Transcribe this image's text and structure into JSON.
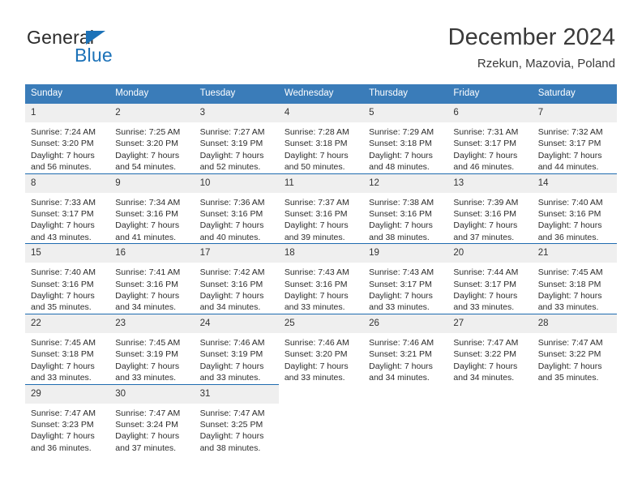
{
  "brand": {
    "line1": "General",
    "line2": "Blue",
    "triangle_color": "#1c72b8"
  },
  "header": {
    "title": "December 2024",
    "subtitle": "Rzekun, Mazovia, Poland"
  },
  "theme": {
    "header_bg": "#3a7cb9",
    "row_divider": "#1f6cb0",
    "daynum_bg": "#efefef",
    "text": "#2c2c2c"
  },
  "weekday_headers": [
    "Sunday",
    "Monday",
    "Tuesday",
    "Wednesday",
    "Thursday",
    "Friday",
    "Saturday"
  ],
  "weeks": [
    {
      "days": [
        {
          "num": "1",
          "sunrise": "Sunrise: 7:24 AM",
          "sunset": "Sunset: 3:20 PM",
          "daylight_1": "Daylight: 7 hours",
          "daylight_2": "and 56 minutes."
        },
        {
          "num": "2",
          "sunrise": "Sunrise: 7:25 AM",
          "sunset": "Sunset: 3:20 PM",
          "daylight_1": "Daylight: 7 hours",
          "daylight_2": "and 54 minutes."
        },
        {
          "num": "3",
          "sunrise": "Sunrise: 7:27 AM",
          "sunset": "Sunset: 3:19 PM",
          "daylight_1": "Daylight: 7 hours",
          "daylight_2": "and 52 minutes."
        },
        {
          "num": "4",
          "sunrise": "Sunrise: 7:28 AM",
          "sunset": "Sunset: 3:18 PM",
          "daylight_1": "Daylight: 7 hours",
          "daylight_2": "and 50 minutes."
        },
        {
          "num": "5",
          "sunrise": "Sunrise: 7:29 AM",
          "sunset": "Sunset: 3:18 PM",
          "daylight_1": "Daylight: 7 hours",
          "daylight_2": "and 48 minutes."
        },
        {
          "num": "6",
          "sunrise": "Sunrise: 7:31 AM",
          "sunset": "Sunset: 3:17 PM",
          "daylight_1": "Daylight: 7 hours",
          "daylight_2": "and 46 minutes."
        },
        {
          "num": "7",
          "sunrise": "Sunrise: 7:32 AM",
          "sunset": "Sunset: 3:17 PM",
          "daylight_1": "Daylight: 7 hours",
          "daylight_2": "and 44 minutes."
        }
      ]
    },
    {
      "days": [
        {
          "num": "8",
          "sunrise": "Sunrise: 7:33 AM",
          "sunset": "Sunset: 3:17 PM",
          "daylight_1": "Daylight: 7 hours",
          "daylight_2": "and 43 minutes."
        },
        {
          "num": "9",
          "sunrise": "Sunrise: 7:34 AM",
          "sunset": "Sunset: 3:16 PM",
          "daylight_1": "Daylight: 7 hours",
          "daylight_2": "and 41 minutes."
        },
        {
          "num": "10",
          "sunrise": "Sunrise: 7:36 AM",
          "sunset": "Sunset: 3:16 PM",
          "daylight_1": "Daylight: 7 hours",
          "daylight_2": "and 40 minutes."
        },
        {
          "num": "11",
          "sunrise": "Sunrise: 7:37 AM",
          "sunset": "Sunset: 3:16 PM",
          "daylight_1": "Daylight: 7 hours",
          "daylight_2": "and 39 minutes."
        },
        {
          "num": "12",
          "sunrise": "Sunrise: 7:38 AM",
          "sunset": "Sunset: 3:16 PM",
          "daylight_1": "Daylight: 7 hours",
          "daylight_2": "and 38 minutes."
        },
        {
          "num": "13",
          "sunrise": "Sunrise: 7:39 AM",
          "sunset": "Sunset: 3:16 PM",
          "daylight_1": "Daylight: 7 hours",
          "daylight_2": "and 37 minutes."
        },
        {
          "num": "14",
          "sunrise": "Sunrise: 7:40 AM",
          "sunset": "Sunset: 3:16 PM",
          "daylight_1": "Daylight: 7 hours",
          "daylight_2": "and 36 minutes."
        }
      ]
    },
    {
      "days": [
        {
          "num": "15",
          "sunrise": "Sunrise: 7:40 AM",
          "sunset": "Sunset: 3:16 PM",
          "daylight_1": "Daylight: 7 hours",
          "daylight_2": "and 35 minutes."
        },
        {
          "num": "16",
          "sunrise": "Sunrise: 7:41 AM",
          "sunset": "Sunset: 3:16 PM",
          "daylight_1": "Daylight: 7 hours",
          "daylight_2": "and 34 minutes."
        },
        {
          "num": "17",
          "sunrise": "Sunrise: 7:42 AM",
          "sunset": "Sunset: 3:16 PM",
          "daylight_1": "Daylight: 7 hours",
          "daylight_2": "and 34 minutes."
        },
        {
          "num": "18",
          "sunrise": "Sunrise: 7:43 AM",
          "sunset": "Sunset: 3:16 PM",
          "daylight_1": "Daylight: 7 hours",
          "daylight_2": "and 33 minutes."
        },
        {
          "num": "19",
          "sunrise": "Sunrise: 7:43 AM",
          "sunset": "Sunset: 3:17 PM",
          "daylight_1": "Daylight: 7 hours",
          "daylight_2": "and 33 minutes."
        },
        {
          "num": "20",
          "sunrise": "Sunrise: 7:44 AM",
          "sunset": "Sunset: 3:17 PM",
          "daylight_1": "Daylight: 7 hours",
          "daylight_2": "and 33 minutes."
        },
        {
          "num": "21",
          "sunrise": "Sunrise: 7:45 AM",
          "sunset": "Sunset: 3:18 PM",
          "daylight_1": "Daylight: 7 hours",
          "daylight_2": "and 33 minutes."
        }
      ]
    },
    {
      "days": [
        {
          "num": "22",
          "sunrise": "Sunrise: 7:45 AM",
          "sunset": "Sunset: 3:18 PM",
          "daylight_1": "Daylight: 7 hours",
          "daylight_2": "and 33 minutes."
        },
        {
          "num": "23",
          "sunrise": "Sunrise: 7:45 AM",
          "sunset": "Sunset: 3:19 PM",
          "daylight_1": "Daylight: 7 hours",
          "daylight_2": "and 33 minutes."
        },
        {
          "num": "24",
          "sunrise": "Sunrise: 7:46 AM",
          "sunset": "Sunset: 3:19 PM",
          "daylight_1": "Daylight: 7 hours",
          "daylight_2": "and 33 minutes."
        },
        {
          "num": "25",
          "sunrise": "Sunrise: 7:46 AM",
          "sunset": "Sunset: 3:20 PM",
          "daylight_1": "Daylight: 7 hours",
          "daylight_2": "and 33 minutes."
        },
        {
          "num": "26",
          "sunrise": "Sunrise: 7:46 AM",
          "sunset": "Sunset: 3:21 PM",
          "daylight_1": "Daylight: 7 hours",
          "daylight_2": "and 34 minutes."
        },
        {
          "num": "27",
          "sunrise": "Sunrise: 7:47 AM",
          "sunset": "Sunset: 3:22 PM",
          "daylight_1": "Daylight: 7 hours",
          "daylight_2": "and 34 minutes."
        },
        {
          "num": "28",
          "sunrise": "Sunrise: 7:47 AM",
          "sunset": "Sunset: 3:22 PM",
          "daylight_1": "Daylight: 7 hours",
          "daylight_2": "and 35 minutes."
        }
      ]
    },
    {
      "days": [
        {
          "num": "29",
          "sunrise": "Sunrise: 7:47 AM",
          "sunset": "Sunset: 3:23 PM",
          "daylight_1": "Daylight: 7 hours",
          "daylight_2": "and 36 minutes."
        },
        {
          "num": "30",
          "sunrise": "Sunrise: 7:47 AM",
          "sunset": "Sunset: 3:24 PM",
          "daylight_1": "Daylight: 7 hours",
          "daylight_2": "and 37 minutes."
        },
        {
          "num": "31",
          "sunrise": "Sunrise: 7:47 AM",
          "sunset": "Sunset: 3:25 PM",
          "daylight_1": "Daylight: 7 hours",
          "daylight_2": "and 38 minutes."
        },
        {
          "num": "",
          "sunrise": "",
          "sunset": "",
          "daylight_1": "",
          "daylight_2": "",
          "empty": true
        },
        {
          "num": "",
          "sunrise": "",
          "sunset": "",
          "daylight_1": "",
          "daylight_2": "",
          "empty": true
        },
        {
          "num": "",
          "sunrise": "",
          "sunset": "",
          "daylight_1": "",
          "daylight_2": "",
          "empty": true
        },
        {
          "num": "",
          "sunrise": "",
          "sunset": "",
          "daylight_1": "",
          "daylight_2": "",
          "empty": true
        }
      ]
    }
  ]
}
